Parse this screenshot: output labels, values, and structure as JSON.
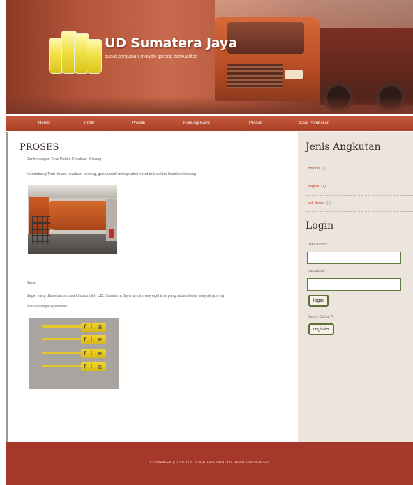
{
  "header": {
    "title": "UD Sumatera Jaya",
    "tagline": "pusat penjualan minyak goreng berkualitas"
  },
  "nav": [
    "Home",
    "Profil",
    "Produk",
    "Hubungi Kami",
    "Proses",
    "Cara Pembelian"
  ],
  "main": {
    "title": "PROSES",
    "section1_title": "Penimbangan Truk Dalam Keadaan Kosong",
    "section1_text": "Menimbang Truk dalam keadaan kosong, guna untuk mengetahui berat truk dalam keadaan kosong",
    "section2_title": "Segel",
    "section2_text_line1": "Segel yang diberikan secara khusus oleh UD. Sumatera Jaya untuk menyegel truk yang sudah berisi minyak goreng",
    "section2_text_line2": "sesuai dengan pesanan."
  },
  "sidebar": {
    "jenis_heading": "Jenis Angkutan",
    "jenis_items": [
      {
        "label": "tronton",
        "count": "(3)"
      },
      {
        "label": "engkel",
        "count": "(1)"
      },
      {
        "label": "coll diesel",
        "count": "(1)"
      }
    ],
    "login_heading": "Login",
    "username_label": "user name :",
    "password_label": "password :",
    "login_button": "login",
    "belum_daftar": "Belum Daftar ?",
    "register_button": "register"
  },
  "footer": {
    "copyright": "COPYRIGHT (C) 2013 UD.SUMATERA JAYA. ALL RIGHTS RESERVED"
  },
  "colors": {
    "nav_bg": "#b5472e",
    "footer_bg": "#a5382a",
    "sidebar_bg": "#ebe5de",
    "link": "#c0391e",
    "button_border": "#5d6f37"
  }
}
